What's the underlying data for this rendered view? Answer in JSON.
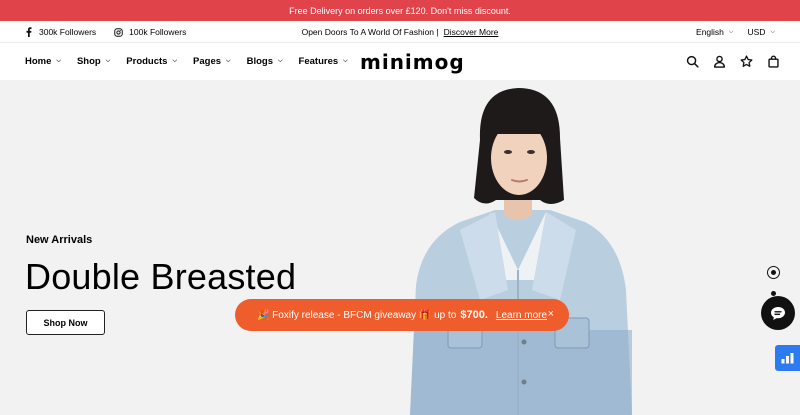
{
  "promo": {
    "text": "Free Delivery on orders over £120. Don't miss discount."
  },
  "topbar": {
    "facebook_followers": "300k Followers",
    "instagram_followers": "100k Followers",
    "tagline": "Open Doors To A World Of Fashion |",
    "discover_link": "Discover More",
    "language": "English",
    "currency": "USD"
  },
  "nav": {
    "items": [
      {
        "label": "Home"
      },
      {
        "label": "Shop"
      },
      {
        "label": "Products"
      },
      {
        "label": "Pages"
      },
      {
        "label": "Blogs"
      },
      {
        "label": "Features"
      }
    ],
    "logo": "minimog",
    "icons": [
      "search-icon",
      "account-icon",
      "wishlist-star-icon",
      "cart-bag-icon"
    ]
  },
  "hero": {
    "subtitle": "New Arrivals",
    "title": "Double Breasted",
    "button": "Shop Now",
    "slides_total": 2,
    "slide_active": 1
  },
  "toast": {
    "text": "🎉 Foxify release - BFCM giveaway 🎁 up to",
    "amount": "$700.",
    "link": "Learn more",
    "close": "×"
  },
  "colors": {
    "promo_bg": "#e0434a",
    "toast_bg": "#ee5d2b",
    "widget_blue": "#2d7bf0",
    "hero_bg": "#f2f2f2"
  }
}
